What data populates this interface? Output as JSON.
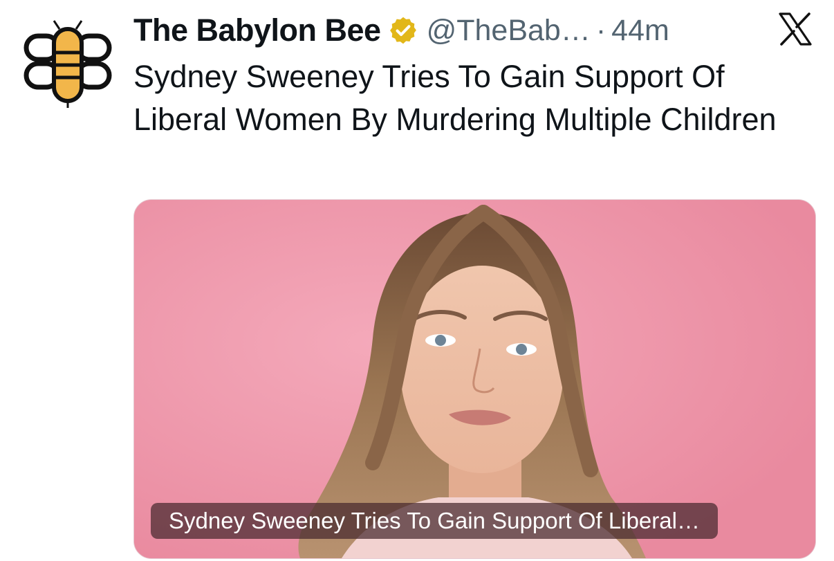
{
  "account": {
    "name": "The Babylon Bee",
    "handle": "@TheBab…",
    "separator": "·",
    "time": "44m",
    "verified_icon": "verified-badge-icon",
    "verified_color": "#e2b719"
  },
  "tweet": {
    "text": "Sydney Sweeney Tries To Gain Support Of Liberal Women By Murdering Multiple Children"
  },
  "media": {
    "caption": "Sydney Sweeney Tries To Gain Support Of Liberal…",
    "background_color": "#ef9aad"
  },
  "icons": {
    "platform": "x-logo-icon",
    "avatar": "babylon-bee-logo-icon"
  },
  "colors": {
    "text_primary": "#0f1419",
    "text_secondary": "#536471",
    "bee_yellow": "#f2b64a"
  }
}
